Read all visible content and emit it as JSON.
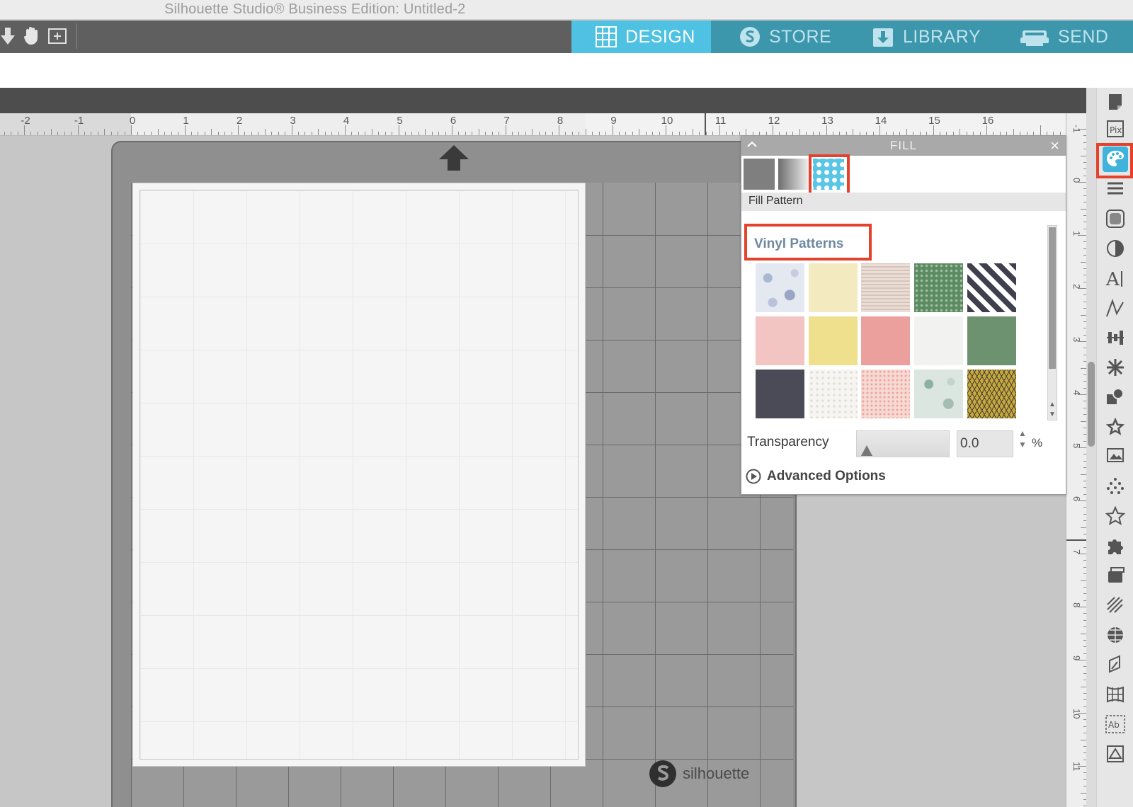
{
  "window": {
    "title": "Silhouette Studio® Business Edition: Untitled-2"
  },
  "nav": {
    "design": "DESIGN",
    "store": "STORE",
    "library": "LIBRARY",
    "send": "SEND"
  },
  "ruler": {
    "labels": [
      "-2",
      "-1",
      "0",
      "1",
      "2",
      "3",
      "4",
      "5",
      "6",
      "7",
      "8",
      "9",
      "10",
      "11",
      "12",
      "13",
      "14",
      "15",
      "16"
    ],
    "vlabels": [
      "-1",
      "0",
      "1",
      "2",
      "3",
      "4",
      "5",
      "6",
      "7",
      "8",
      "9",
      "10",
      "11"
    ]
  },
  "mat": {
    "brand": "silhouette"
  },
  "fill_panel": {
    "title": "FILL",
    "subtab_label": "Fill Pattern",
    "section_label": "Vinyl Patterns",
    "transparency_label": "Transparency",
    "transparency_value": "0.0",
    "transparency_unit": "%",
    "advanced_options": "Advanced Options"
  },
  "colors": {
    "accent_design": "#4fc1e3",
    "nav_tab": "#3c97ad",
    "highlight_red": "#e4422c"
  }
}
